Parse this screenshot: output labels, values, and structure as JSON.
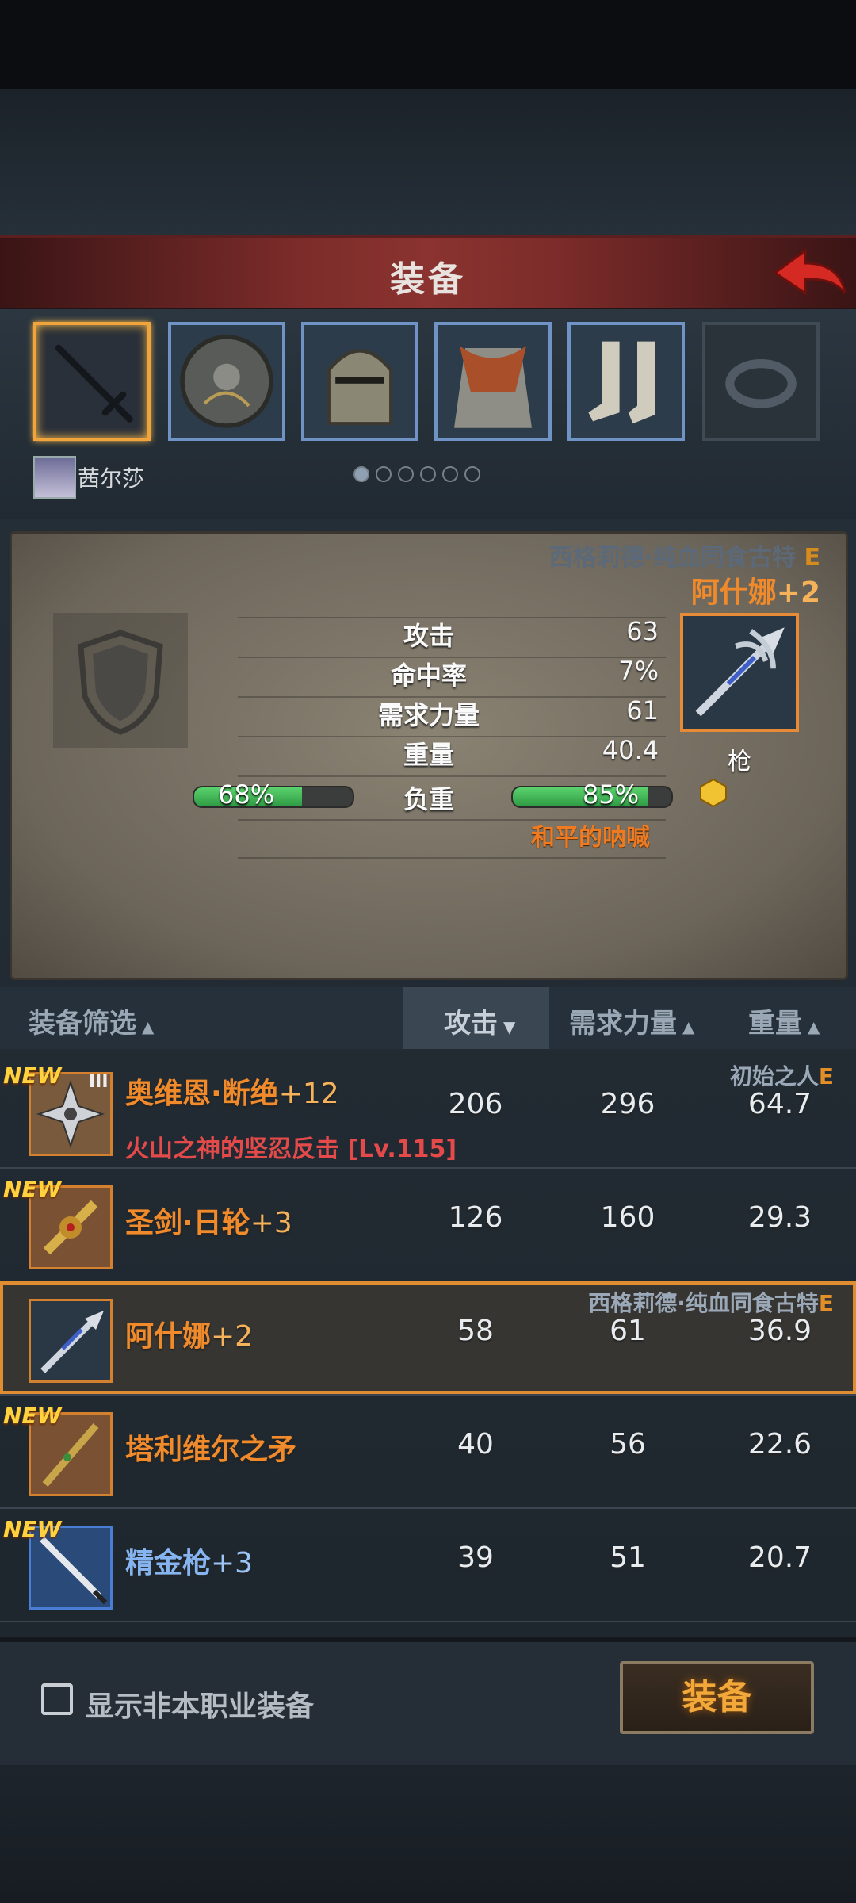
{
  "header": {
    "title": "装备"
  },
  "slots": {
    "character_name": "茜尔莎",
    "page_dots": 6,
    "active_dot": 0
  },
  "detail": {
    "owner": "西格莉德·纯血同食古特",
    "owner_grade": "E",
    "item_name": "阿什娜",
    "item_plus": "+2",
    "item_type": "枪",
    "stats": [
      {
        "label": "攻击",
        "value": "63"
      },
      {
        "label": "命中率",
        "value": "7%"
      },
      {
        "label": "需求力量",
        "value": "61"
      },
      {
        "label": "重量",
        "value": "40.4"
      }
    ],
    "load_label": "负重",
    "load_left": "68%",
    "load_left_fraction": 0.68,
    "load_right": "85%",
    "load_right_fraction": 0.85,
    "skill": "和平的呐喊"
  },
  "list_header": {
    "filter": "装备筛选",
    "attack": "攻击",
    "strength": "需求力量",
    "weight": "重量"
  },
  "items": [
    {
      "new": "NEW",
      "tier": "III",
      "name": "奥维恩·断绝",
      "plus": "+12",
      "attack": "206",
      "strength": "296",
      "weight": "64.7",
      "owner": "初始之人",
      "grade": "E",
      "sub": "火山之神的坚忍反击 [Lv.115]"
    },
    {
      "new": "NEW",
      "name": "圣剑·日轮",
      "plus": "+3",
      "attack": "126",
      "strength": "160",
      "weight": "29.3"
    },
    {
      "name": "阿什娜",
      "plus": "+2",
      "attack": "58",
      "strength": "61",
      "weight": "36.9",
      "owner": "西格莉德·纯血同食古特",
      "grade": "E"
    },
    {
      "new": "NEW",
      "name": "塔利维尔之矛",
      "plus": "",
      "attack": "40",
      "strength": "56",
      "weight": "22.6"
    },
    {
      "new": "NEW",
      "name": "精金枪",
      "plus": "+3",
      "attack": "39",
      "strength": "51",
      "weight": "20.7"
    }
  ],
  "footer": {
    "checkbox_label": "显示非本职业装备",
    "equip_button": "装备"
  },
  "colors": {
    "accent": "#f08a2a",
    "rare_blue": "#86b4f0",
    "load_bar": "#3fb556",
    "header_red": "#7c2c2a"
  }
}
